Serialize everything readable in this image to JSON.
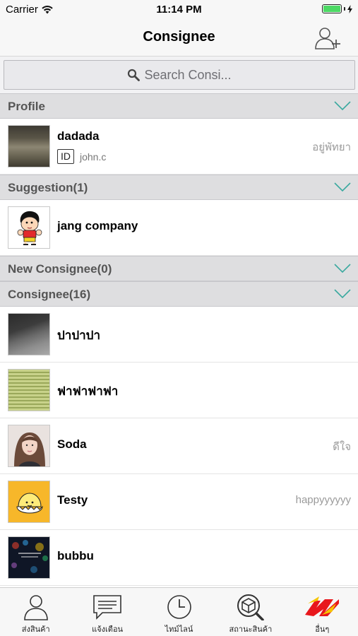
{
  "status_bar": {
    "carrier": "Carrier",
    "time": "11:14 PM"
  },
  "nav": {
    "title": "Consignee",
    "add_icon": "add-user-icon"
  },
  "search": {
    "placeholder": "Search Consi..."
  },
  "sections": {
    "profile": {
      "label": "Profile"
    },
    "suggestion": {
      "label": "Suggestion(1)"
    },
    "new_consignee": {
      "label": "New Consignee(0)"
    },
    "consignee": {
      "label": "Consignee(16)"
    }
  },
  "profile": {
    "name": "dadada",
    "id_badge": "ID",
    "user_id": "john.c",
    "status": "อยู่พัทยา"
  },
  "suggestion": {
    "name": "jang company"
  },
  "consignees": [
    {
      "name": "ปาปาปา",
      "status": ""
    },
    {
      "name": "ฟาฟาฟาฟา",
      "status": ""
    },
    {
      "name": "Soda",
      "status": "ดีใจ"
    },
    {
      "name": "Testy",
      "status": "happyyyyyy"
    },
    {
      "name": "bubbu",
      "status": ""
    }
  ],
  "tabs": [
    {
      "label": "ส่งสินค้า",
      "icon": "person-icon"
    },
    {
      "label": "แจ้งเตือน",
      "icon": "message-icon"
    },
    {
      "label": "ไทม์ไลน์",
      "icon": "clock-icon"
    },
    {
      "label": "สถานะสินค้า",
      "icon": "package-search-icon"
    },
    {
      "label": "อื่นๆ",
      "icon": "brand-logo-icon"
    }
  ],
  "colors": {
    "chevron": "#3aa99f",
    "battery": "#4cd964",
    "section_bg": "#dedee0"
  }
}
